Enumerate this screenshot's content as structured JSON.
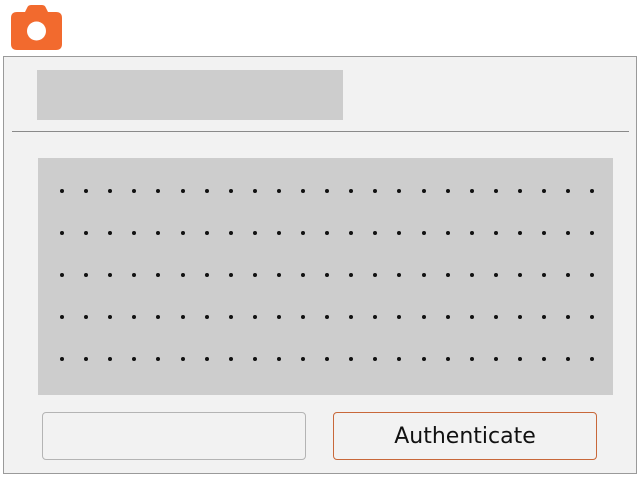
{
  "app": {
    "icon": "camera-icon",
    "accent_color": "#f26a2e"
  },
  "dialog": {
    "title": "",
    "code_grid": {
      "rows": 5,
      "columns": 23,
      "dot_color": "#111111"
    },
    "buttons": {
      "secondary_label": "",
      "primary_label": "Authenticate"
    }
  }
}
